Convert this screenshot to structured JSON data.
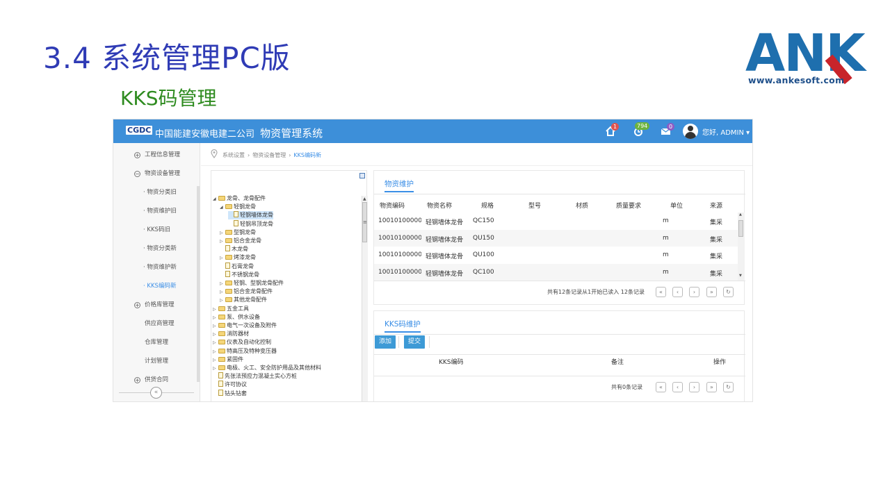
{
  "slide": {
    "title": "3.4 系统管理PC版",
    "subtitle": "KKS码管理",
    "logo": {
      "letters": "ANK",
      "url": "www.ankesoft.com"
    }
  },
  "header": {
    "brand_mark": "CGDC",
    "company": "中国能建安徽电建二公司",
    "system": "物资管理系统",
    "home_badge": "1",
    "notice_badge": "794",
    "mail_badge": "0",
    "user": "您好, ADMIN ▾",
    "colors": {
      "bar": "#3d8fd9",
      "accent": "#3a8ee6",
      "button": "#3d9ad6"
    }
  },
  "sidebar": {
    "items": [
      {
        "label": "工程信息管理",
        "toggle": "+"
      },
      {
        "label": "物资设备管理",
        "toggle": "−"
      },
      {
        "label": "· 物资分类旧"
      },
      {
        "label": "· 物资维护旧"
      },
      {
        "label": "· KKS码旧"
      },
      {
        "label": "· 物资分类新"
      },
      {
        "label": "· 物资维护新"
      },
      {
        "label": "· KKS编码新"
      },
      {
        "label": "价格库管理",
        "toggle": "+"
      },
      {
        "label": "供应商管理"
      },
      {
        "label": "仓库管理"
      },
      {
        "label": "计划管理"
      },
      {
        "label": "供货合同",
        "toggle": "+"
      }
    ],
    "collapse": "«"
  },
  "breadcrumb": {
    "items": [
      "系统设置",
      "物资设备管理",
      "KKS编码新"
    ],
    "sep": "›"
  },
  "tree": {
    "nodes": [
      {
        "label": "龙骨、龙骨配件",
        "toggle": "◢",
        "type": "folder"
      },
      {
        "label": "轻钢龙骨",
        "toggle": "◢",
        "type": "folder"
      },
      {
        "label": "轻钢墙体龙骨",
        "toggle": "",
        "type": "file"
      },
      {
        "label": "轻钢吊顶龙骨",
        "toggle": "",
        "type": "file"
      },
      {
        "label": "型钢龙骨",
        "toggle": "▷",
        "type": "folder"
      },
      {
        "label": "铝合金龙骨",
        "toggle": "▷",
        "type": "folder"
      },
      {
        "label": "木龙骨",
        "toggle": "",
        "type": "file"
      },
      {
        "label": "烤漆龙骨",
        "toggle": "▷",
        "type": "folder"
      },
      {
        "label": "石膏龙骨",
        "toggle": "",
        "type": "file"
      },
      {
        "label": "不锈钢龙骨",
        "toggle": "",
        "type": "file"
      },
      {
        "label": "轻钢、型钢龙骨配件",
        "toggle": "▷",
        "type": "folder"
      },
      {
        "label": "铝合金龙骨配件",
        "toggle": "▷",
        "type": "folder"
      },
      {
        "label": "其他龙骨配件",
        "toggle": "▷",
        "type": "folder"
      },
      {
        "label": "五金工具",
        "toggle": "▷",
        "type": "folder"
      },
      {
        "label": "泵、供水设备",
        "toggle": "▷",
        "type": "folder"
      },
      {
        "label": "电气一次设备及附件",
        "toggle": "▷",
        "type": "folder"
      },
      {
        "label": "消防器材",
        "toggle": "▷",
        "type": "folder"
      },
      {
        "label": "仪表及自动化控制",
        "toggle": "▷",
        "type": "folder"
      },
      {
        "label": "特高压及特种变压器",
        "toggle": "▷",
        "type": "folder"
      },
      {
        "label": "紧固件",
        "toggle": "▷",
        "type": "folder"
      },
      {
        "label": "电极、火工、安全防护用品及其他材料",
        "toggle": "▷",
        "type": "folder"
      },
      {
        "label": "先张法预应力混凝土实心方桩",
        "toggle": "",
        "type": "file"
      },
      {
        "label": "许可协议",
        "toggle": "",
        "type": "file"
      },
      {
        "label": "钻头钻套",
        "toggle": "",
        "type": "file"
      }
    ]
  },
  "materials": {
    "tab": "物资维护",
    "columns": [
      "物资编码",
      "物资名称",
      "规格",
      "型号",
      "材质",
      "质量要求",
      "单位",
      "来源"
    ],
    "rows": [
      [
        "10010100000",
        "轻钢墙体龙骨",
        "QC150",
        "",
        "",
        "",
        "m",
        "集采"
      ],
      [
        "10010100000",
        "轻钢墙体龙骨",
        "QU150",
        "",
        "",
        "",
        "m",
        "集采"
      ],
      [
        "10010100000",
        "轻钢墙体龙骨",
        "QU100",
        "",
        "",
        "",
        "m",
        "集采"
      ],
      [
        "10010100000",
        "轻钢墙体龙骨",
        "QC100",
        "",
        "",
        "",
        "m",
        "集采"
      ]
    ],
    "pager": "共有12条记录从1开始已读入 12条记录"
  },
  "kks": {
    "tab": "KKS码维护",
    "add_label": "添加",
    "submit_label": "提交",
    "columns": [
      "KKS编码",
      "备注",
      "操作"
    ],
    "pager": "共有0条记录"
  },
  "pager_buttons": [
    "«",
    "‹",
    "›",
    "»",
    "↻"
  ]
}
